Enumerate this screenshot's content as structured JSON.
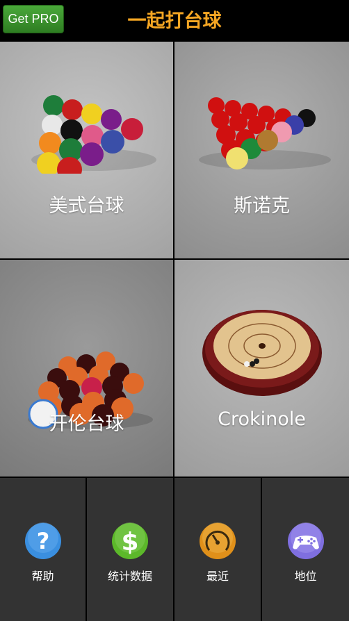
{
  "header": {
    "pro_button": "Get PRO",
    "title": "一起打台球"
  },
  "games": [
    {
      "label": "美式台球"
    },
    {
      "label": "斯诺克"
    },
    {
      "label": "开伦台球"
    },
    {
      "label": "Crokinole"
    }
  ],
  "bottom_nav": [
    {
      "label": "帮助",
      "icon": "help-icon"
    },
    {
      "label": "统计数据",
      "icon": "dollar-icon"
    },
    {
      "label": "最近",
      "icon": "clock-icon"
    },
    {
      "label": "地位",
      "icon": "gamepad-icon"
    }
  ],
  "colors": {
    "title": "#f5a623",
    "pro_button": "#3c9a2e",
    "help": "#3a8fe0",
    "stats": "#5cb82a",
    "recent": "#e0901a",
    "status": "#7f6fe0"
  }
}
